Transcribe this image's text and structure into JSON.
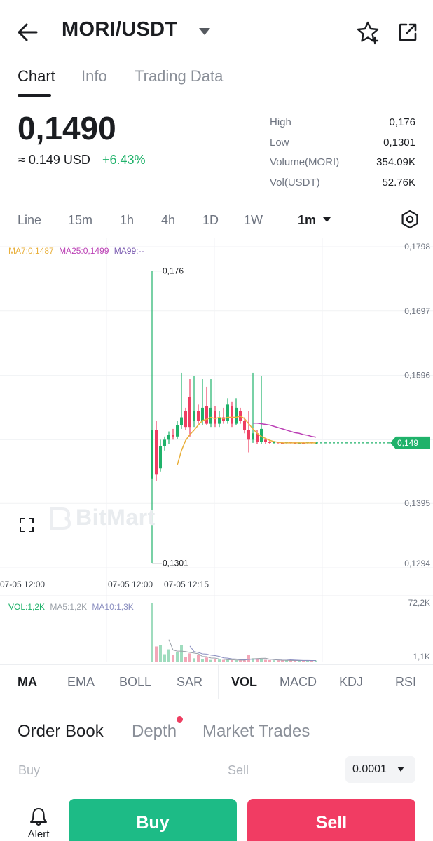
{
  "header": {
    "pair": "MORI/USDT",
    "icons": [
      "back-arrow-icon",
      "dropdown-caret-icon",
      "star-plus-icon",
      "share-external-icon"
    ]
  },
  "tabs": [
    {
      "label": "Chart",
      "active": true
    },
    {
      "label": "Info",
      "active": false
    },
    {
      "label": "Trading Data",
      "active": false
    }
  ],
  "price": {
    "last": "0,1490",
    "usd": "≈ 0.149 USD",
    "change": "+6.43%",
    "change_color": "#1fb26a"
  },
  "stats": [
    {
      "label": "High",
      "value": "0,176"
    },
    {
      "label": "Low",
      "value": "0,1301"
    },
    {
      "label": "Volume(MORI)",
      "value": "354.09K"
    },
    {
      "label": "Vol(USDT)",
      "value": "52.76K"
    }
  ],
  "intervals": {
    "items": [
      "Line",
      "15m",
      "1h",
      "4h",
      "1D",
      "1W"
    ],
    "selected": "1m"
  },
  "chart": {
    "ma_legend": {
      "ma7": "MA7:0,1487",
      "ma25": "MA25:0,1499",
      "ma99": "MA99:--"
    },
    "vol_legend": {
      "vol": "VOL:1,2K",
      "ma5": "MA5:1,2K",
      "ma10": "MA10:1,3K"
    },
    "watermark": "BitMart",
    "colors": {
      "up": "#1fb26a",
      "down": "#ee3e61",
      "ma7": "#e9b03c",
      "ma25": "#bb3fb5",
      "ma99": "#7a5ab0"
    }
  },
  "chart_data": {
    "type": "candlestick",
    "title": "",
    "price_axis_ticks": [
      "0,1798",
      "0,1697",
      "0,1596",
      "0,1395",
      "0,1294"
    ],
    "time_axis_ticks": [
      "07-05 12:00",
      "07-05 12:00",
      "07-05 12:15"
    ],
    "ylim": [
      0.1294,
      0.1798
    ],
    "current_price_label": "0,149",
    "current_price": 0.149,
    "high_marker": {
      "label": "0,176",
      "value": 0.176
    },
    "low_marker": {
      "label": "0,1301",
      "value": 0.1301
    },
    "candles": [
      {
        "o": 0.1434,
        "c": 0.151,
        "h": 0.176,
        "l": 0.1301,
        "up": true
      },
      {
        "o": 0.151,
        "c": 0.144,
        "h": 0.1525,
        "l": 0.143,
        "up": false
      },
      {
        "o": 0.145,
        "c": 0.1485,
        "h": 0.1495,
        "l": 0.1445,
        "up": true
      },
      {
        "o": 0.1485,
        "c": 0.1495,
        "h": 0.15,
        "l": 0.1478,
        "up": true
      },
      {
        "o": 0.1495,
        "c": 0.1502,
        "h": 0.1508,
        "l": 0.1488,
        "up": true
      },
      {
        "o": 0.1502,
        "c": 0.15,
        "h": 0.1512,
        "l": 0.1495,
        "up": false
      },
      {
        "o": 0.15,
        "c": 0.1518,
        "h": 0.1525,
        "l": 0.1496,
        "up": true
      },
      {
        "o": 0.1518,
        "c": 0.153,
        "h": 0.16,
        "l": 0.1512,
        "up": true
      },
      {
        "o": 0.154,
        "c": 0.1515,
        "h": 0.1545,
        "l": 0.151,
        "up": false
      },
      {
        "o": 0.1515,
        "c": 0.1562,
        "h": 0.159,
        "l": 0.15,
        "up": false
      },
      {
        "o": 0.1525,
        "c": 0.154,
        "h": 0.1595,
        "l": 0.1515,
        "up": true
      },
      {
        "o": 0.154,
        "c": 0.1525,
        "h": 0.155,
        "l": 0.152,
        "up": false
      },
      {
        "o": 0.1525,
        "c": 0.1545,
        "h": 0.159,
        "l": 0.1518,
        "up": true
      },
      {
        "o": 0.1548,
        "c": 0.152,
        "h": 0.1578,
        "l": 0.1518,
        "up": false
      },
      {
        "o": 0.152,
        "c": 0.1545,
        "h": 0.159,
        "l": 0.1515,
        "up": true
      },
      {
        "o": 0.154,
        "c": 0.152,
        "h": 0.1548,
        "l": 0.1515,
        "up": false
      },
      {
        "o": 0.152,
        "c": 0.153,
        "h": 0.154,
        "l": 0.1515,
        "up": true
      },
      {
        "o": 0.153,
        "c": 0.1525,
        "h": 0.1545,
        "l": 0.152,
        "up": false
      },
      {
        "o": 0.1525,
        "c": 0.155,
        "h": 0.156,
        "l": 0.152,
        "up": true
      },
      {
        "o": 0.1548,
        "c": 0.152,
        "h": 0.1555,
        "l": 0.1515,
        "up": false
      },
      {
        "o": 0.152,
        "c": 0.1545,
        "h": 0.156,
        "l": 0.1518,
        "up": true
      },
      {
        "o": 0.154,
        "c": 0.1525,
        "h": 0.1545,
        "l": 0.152,
        "up": false
      },
      {
        "o": 0.1525,
        "c": 0.151,
        "h": 0.153,
        "l": 0.1505,
        "up": false
      },
      {
        "o": 0.151,
        "c": 0.1495,
        "h": 0.154,
        "l": 0.1475,
        "up": false
      },
      {
        "o": 0.1495,
        "c": 0.1505,
        "h": 0.16,
        "l": 0.149,
        "up": true
      },
      {
        "o": 0.1505,
        "c": 0.1492,
        "h": 0.151,
        "l": 0.1488,
        "up": false
      },
      {
        "o": 0.1492,
        "c": 0.1512,
        "h": 0.1595,
        "l": 0.1488,
        "up": true
      },
      {
        "o": 0.1495,
        "c": 0.1492,
        "h": 0.1498,
        "l": 0.1488,
        "up": false
      },
      {
        "o": 0.1492,
        "c": 0.149,
        "h": 0.1495,
        "l": 0.1488,
        "up": false
      },
      {
        "o": 0.149,
        "c": 0.1491,
        "h": 0.1493,
        "l": 0.1489,
        "up": true
      },
      {
        "o": 0.1491,
        "c": 0.149,
        "h": 0.1492,
        "l": 0.1489,
        "up": false
      },
      {
        "o": 0.149,
        "c": 0.149,
        "h": 0.1491,
        "l": 0.1489,
        "up": false
      },
      {
        "o": 0.149,
        "c": 0.1491,
        "h": 0.1492,
        "l": 0.1489,
        "up": true
      },
      {
        "o": 0.1491,
        "c": 0.149,
        "h": 0.1491,
        "l": 0.1489,
        "up": false
      },
      {
        "o": 0.149,
        "c": 0.149,
        "h": 0.1491,
        "l": 0.1489,
        "up": false
      },
      {
        "o": 0.149,
        "c": 0.149,
        "h": 0.1491,
        "l": 0.1489,
        "up": true
      },
      {
        "o": 0.149,
        "c": 0.149,
        "h": 0.1491,
        "l": 0.1489,
        "up": false
      },
      {
        "o": 0.149,
        "c": 0.1491,
        "h": 0.1492,
        "l": 0.1489,
        "up": true
      },
      {
        "o": 0.1491,
        "c": 0.149,
        "h": 0.1491,
        "l": 0.1489,
        "up": false
      },
      {
        "o": 0.149,
        "c": 0.149,
        "h": 0.1491,
        "l": 0.1489,
        "up": true
      }
    ],
    "ma7": [
      null,
      null,
      null,
      null,
      null,
      null,
      0.1455,
      0.1478,
      0.1494,
      0.1503,
      0.151,
      0.1518,
      0.1525,
      0.1527,
      0.153,
      0.1528,
      0.153,
      0.1528,
      0.153,
      0.153,
      0.153,
      0.1532,
      0.1528,
      0.152,
      0.1512,
      0.1505,
      0.15,
      0.1497,
      0.1494,
      0.1492,
      0.1491,
      0.149,
      0.149,
      0.149,
      0.149,
      0.149,
      0.149,
      0.149,
      0.149,
      0.149
    ],
    "ma25": [
      null,
      null,
      null,
      null,
      null,
      null,
      null,
      null,
      null,
      null,
      null,
      null,
      null,
      null,
      null,
      null,
      null,
      null,
      null,
      null,
      null,
      null,
      null,
      null,
      0.1521,
      0.1521,
      0.152,
      0.1519,
      0.1518,
      0.1516,
      0.1514,
      0.1512,
      0.151,
      0.1508,
      0.1506,
      0.1505,
      0.1503,
      0.1502,
      0.15,
      0.1499
    ],
    "volume_axis_ticks": [
      "72,2K",
      "1,1K"
    ],
    "volume_ylim": [
      0,
      72.2
    ],
    "volume": [
      72.2,
      18.5,
      20.0,
      9.0,
      15.0,
      8.0,
      12.0,
      20.0,
      6.0,
      10.0,
      4.0,
      8.0,
      3.0,
      5.0,
      2.0,
      3.0,
      2.5,
      2.0,
      2.0,
      1.8,
      1.6,
      1.5,
      1.5,
      8.0,
      4.0,
      3.5,
      3.0,
      2.0,
      1.8,
      1.6,
      1.5,
      1.4,
      1.3,
      1.3,
      1.2,
      1.2,
      1.2,
      1.2,
      1.2,
      1.2
    ]
  },
  "indicators": {
    "main": [
      "MA",
      "EMA",
      "BOLL",
      "SAR"
    ],
    "sub": [
      "VOL",
      "MACD",
      "KDJ",
      "RSI"
    ],
    "main_active": "MA",
    "sub_active": "VOL"
  },
  "orderbook": {
    "tabs": [
      "Order Book",
      "Depth",
      "Market Trades"
    ],
    "buy_header": "Buy",
    "sell_header": "Sell",
    "precision": "0.0001"
  },
  "bottom": {
    "alert_label": "Alert",
    "buy_label": "Buy",
    "sell_label": "Sell"
  }
}
